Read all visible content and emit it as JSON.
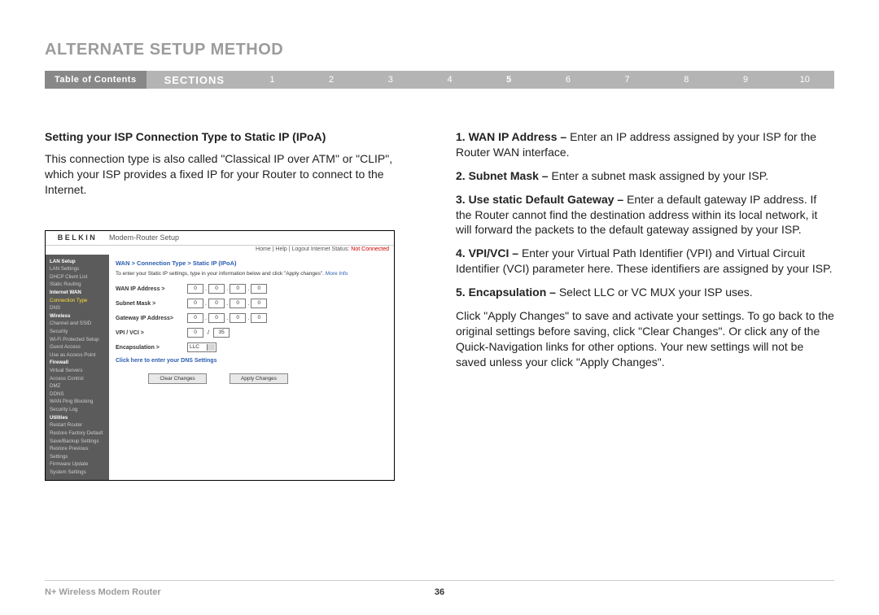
{
  "page_title": "ALTERNATE SETUP METHOD",
  "nav": {
    "toc": "Table of Contents",
    "sections": "SECTIONS",
    "nums": [
      "1",
      "2",
      "3",
      "4",
      "5",
      "6",
      "7",
      "8",
      "9",
      "10"
    ],
    "active": "5"
  },
  "left": {
    "heading": "Setting your ISP Connection Type to Static IP (IPoA)",
    "para": "This connection type is also called \"Classical IP over ATM\" or \"CLIP\", which your ISP provides a fixed IP for your Router to connect to the Internet."
  },
  "right": {
    "items": [
      {
        "n": "1.",
        "lbl": "WAN IP Address – ",
        "txt": "Enter an IP address assigned by your ISP for the Router WAN interface."
      },
      {
        "n": "2.",
        "lbl": "Subnet Mask – ",
        "txt": "Enter a subnet mask assigned by your ISP."
      },
      {
        "n": "3.",
        "lbl": "Use static Default Gateway – ",
        "txt": "Enter a default gateway IP address. If the Router cannot find the destination address within its local network, it will forward the packets to the default gateway assigned by your ISP."
      },
      {
        "n": "4.",
        "lbl": "VPI/VCI – ",
        "txt": "Enter your Virtual Path Identifier (VPI) and Virtual Circuit Identifier (VCI) parameter here. These identifiers are assigned by your ISP."
      },
      {
        "n": "5.",
        "lbl": "Encapsulation – ",
        "txt": "Select LLC or VC MUX your ISP uses."
      }
    ],
    "tail": "Click \"Apply Changes\" to save and activate your settings. To go back to the original settings before saving, click \"Clear Changes\". Or click any of the Quick-Navigation links for other options. Your new settings will not be saved unless your click \"Apply Changes\"."
  },
  "shot": {
    "logo": "BELKIN",
    "title": "Modem-Router Setup",
    "statusbar": "Home | Help | Logout  Internet Status:",
    "status_val": "Not Connected",
    "nav_items": [
      {
        "t": "LAN Setup",
        "c": "hd"
      },
      {
        "t": "LAN Settings"
      },
      {
        "t": "DHCP Client List"
      },
      {
        "t": "Static Routing"
      },
      {
        "t": "Internet WAN",
        "c": "hd"
      },
      {
        "t": "Connection Type",
        "c": "act"
      },
      {
        "t": "DNS"
      },
      {
        "t": "Wireless",
        "c": "hd"
      },
      {
        "t": "Channel and SSID"
      },
      {
        "t": "Security"
      },
      {
        "t": "Wi-Fi Protected Setup"
      },
      {
        "t": "Guest Access"
      },
      {
        "t": "Use as Access Point"
      },
      {
        "t": "Firewall",
        "c": "hd"
      },
      {
        "t": "Virtual Servers"
      },
      {
        "t": "Access Control"
      },
      {
        "t": "DMZ"
      },
      {
        "t": "DDNS"
      },
      {
        "t": "WAN Ping Blocking"
      },
      {
        "t": "Security Log"
      },
      {
        "t": "Utilities",
        "c": "hd"
      },
      {
        "t": "Restart Router"
      },
      {
        "t": "Restore Factory Default"
      },
      {
        "t": "Save/Backup Settings"
      },
      {
        "t": "Restore Previous Settings"
      },
      {
        "t": "Firmware Update"
      },
      {
        "t": "System Settings"
      }
    ],
    "crumb": "WAN > Connection Type > Static IP (IPoA)",
    "instr": "To enter your Static IP settings, type in your information below and click \"Apply changes\".",
    "more_info": "More Info",
    "rows": {
      "wan": "WAN IP Address >",
      "mask": "Subnet Mask >",
      "gw": "Gateway IP Address>",
      "vpi": "VPI / VCI >",
      "enc": "Encapsulation >",
      "enc_val": "LLC"
    },
    "oct_default": "0",
    "vci_default": "35",
    "dns_link": "Click here to enter your DNS Settings",
    "btn_clear": "Clear Changes",
    "btn_apply": "Apply Changes"
  },
  "footer": {
    "product": "N+ Wireless Modem Router",
    "page": "36"
  }
}
